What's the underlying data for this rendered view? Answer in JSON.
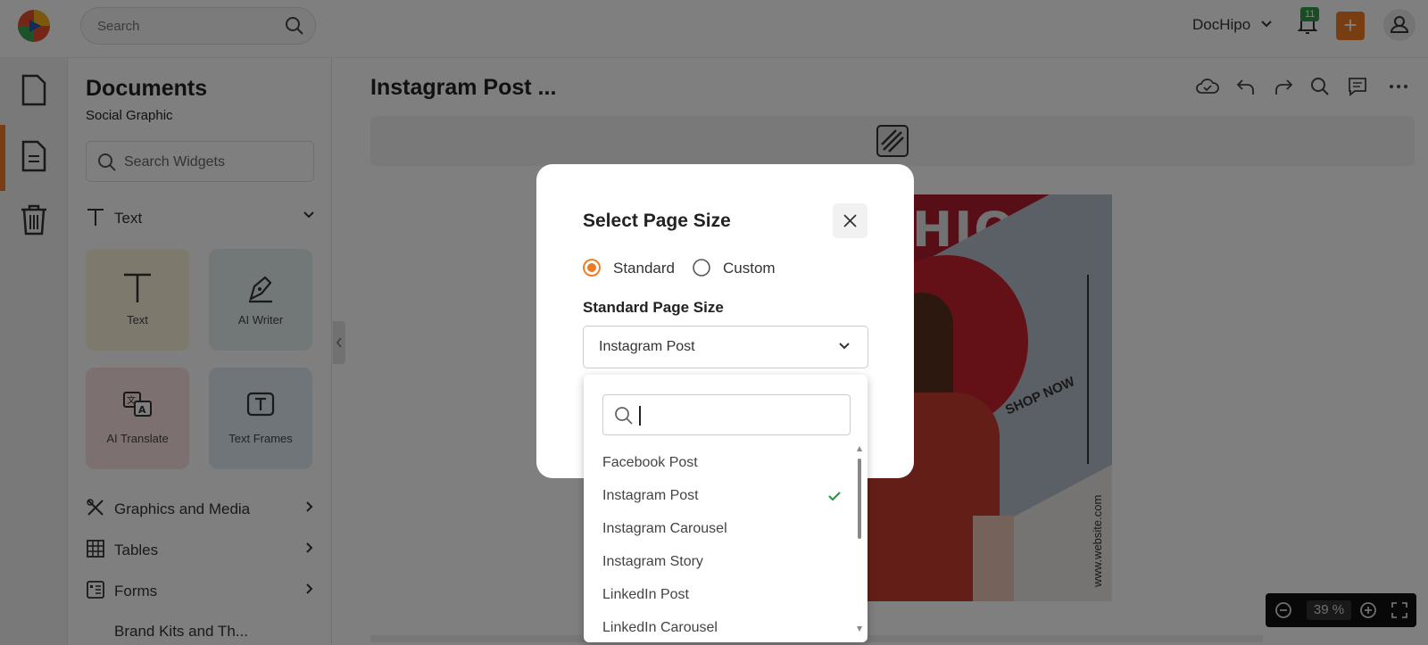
{
  "header": {
    "search_placeholder": "Search",
    "account_name": "DocHipo",
    "notification_count": "11",
    "add_label": "+"
  },
  "panel": {
    "title": "Documents",
    "subtitle": "Social Graphic",
    "search_placeholder": "Search Widgets",
    "text_section": "Text",
    "tiles": [
      {
        "label": "Text",
        "icon": "text-icon"
      },
      {
        "label": "AI Writer",
        "icon": "pen-icon"
      },
      {
        "label": "AI Translate",
        "icon": "translate-icon"
      },
      {
        "label": "Text Frames",
        "icon": "text-frame-icon"
      }
    ],
    "sections": [
      {
        "label": "Graphics and Media",
        "icon": "graphics-icon"
      },
      {
        "label": "Tables",
        "icon": "table-icon"
      },
      {
        "label": "Forms",
        "icon": "form-icon"
      }
    ],
    "partial_section": "Brand Kits and Th..."
  },
  "main": {
    "title": "Instagram Post ...",
    "canvas": {
      "headline": "HION",
      "shop_now": "SHOP NOW",
      "website": "www.website.com"
    },
    "zoom_value": "39 %"
  },
  "modal": {
    "title": "Select Page Size",
    "radio_standard": "Standard",
    "radio_custom": "Custom",
    "selected_radio": "Standard",
    "size_label": "Standard Page Size",
    "selected_value": "Instagram Post"
  },
  "dropdown": {
    "search_value": "",
    "options": [
      "Facebook Post",
      "Instagram Post",
      "Instagram Carousel",
      "Instagram Story",
      "LinkedIn Post",
      "LinkedIn Carousel"
    ],
    "selected": "Instagram Post"
  },
  "colors": {
    "accent": "#f07a21",
    "check": "#2e9a45",
    "brand_red": "#b01d2c"
  }
}
